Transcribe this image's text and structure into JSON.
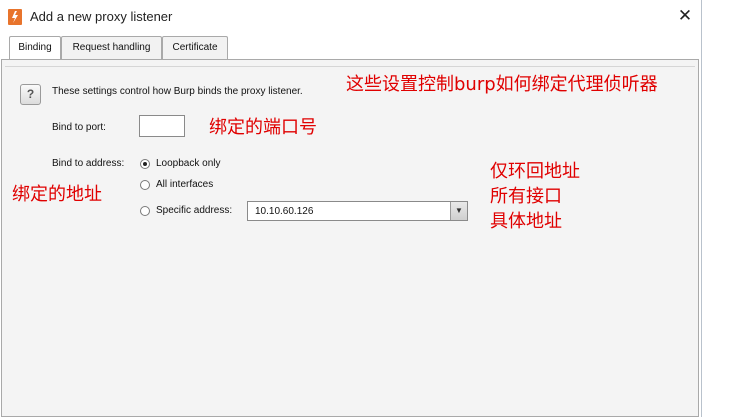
{
  "window": {
    "title": "Add a new proxy listener",
    "close_glyph": "✕"
  },
  "tabs": [
    {
      "label": "Binding",
      "active": true
    },
    {
      "label": "Request handling",
      "active": false
    },
    {
      "label": "Certificate",
      "active": false
    }
  ],
  "binding": {
    "description": "These settings control how Burp binds the proxy listener.",
    "port_label": "Bind to port:",
    "port_value": "",
    "address_label": "Bind to address:",
    "options": {
      "loopback": "Loopback only",
      "all": "All interfaces",
      "specific": "Specific address:"
    },
    "selected_option": "loopback",
    "specific_address_value": "10.10.60.126"
  },
  "annotations": {
    "description_cn": "这些设置控制burp如何绑定代理侦听器",
    "port_cn": "绑定的端口号",
    "address_cn": "绑定的地址",
    "loopback_cn": "仅环回地址",
    "all_cn": "所有接口",
    "specific_cn": "具体地址"
  },
  "colors": {
    "annotation": "#e00000",
    "app_icon": "#e8742c"
  },
  "icons": {
    "app": "burp-logo-icon",
    "help": "help-icon",
    "close": "close-icon",
    "dropdown": "chevron-down-icon"
  }
}
